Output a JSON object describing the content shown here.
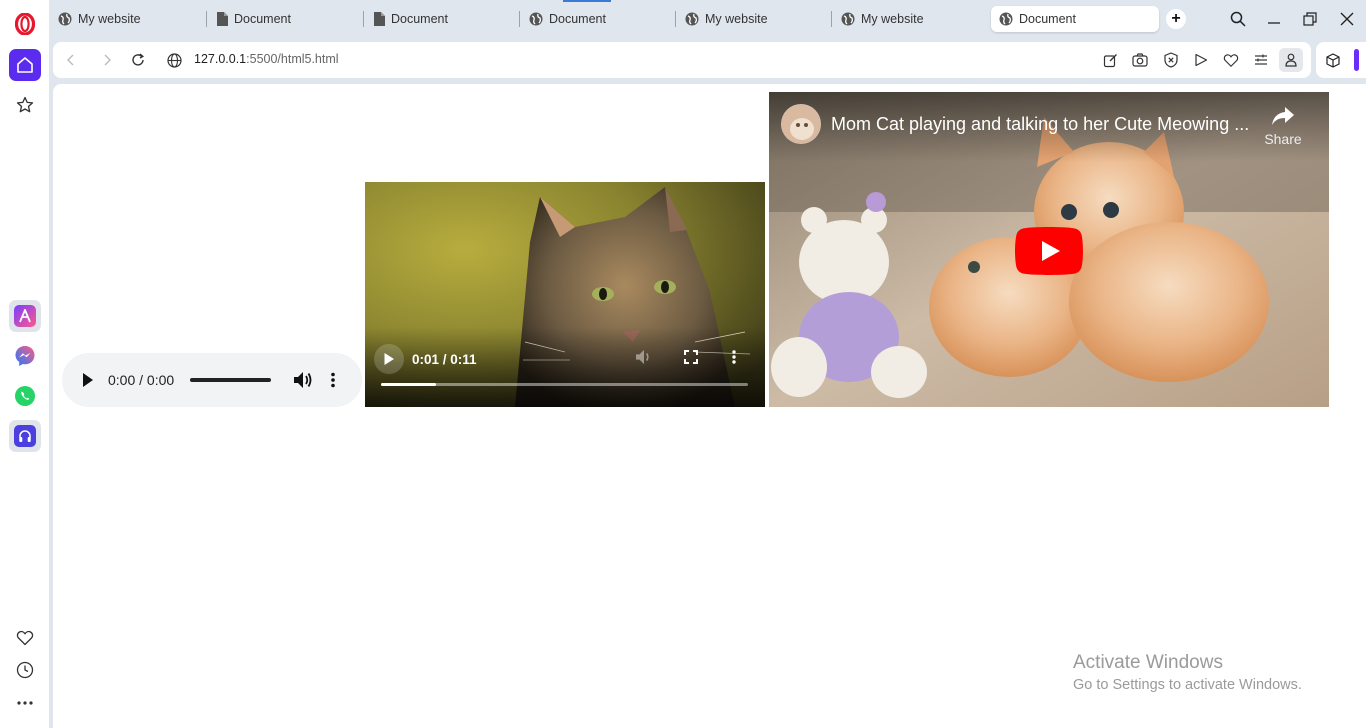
{
  "browser": {
    "tabs": [
      {
        "title": "My website",
        "icon": "globe-icon",
        "active": false
      },
      {
        "title": "Document",
        "icon": "document-icon",
        "active": false
      },
      {
        "title": "Document",
        "icon": "document-icon",
        "active": false
      },
      {
        "title": "Document",
        "icon": "globe-icon",
        "active": false
      },
      {
        "title": "My website",
        "icon": "globe-icon",
        "active": false
      },
      {
        "title": "My website",
        "icon": "globe-icon",
        "active": false
      },
      {
        "title": "Document",
        "icon": "globe-icon",
        "active": true
      }
    ],
    "address": {
      "host": "127.0.0.1",
      "path": ":5500/html5.html"
    },
    "accent_color": "#6a2bff"
  },
  "sidebar": {
    "items": [
      {
        "name": "opera-logo",
        "icon": "opera-icon"
      },
      {
        "name": "home",
        "icon": "home-icon"
      },
      {
        "name": "speed-dial",
        "icon": "star-icon"
      },
      {
        "name": "aria",
        "icon": "aria-icon"
      },
      {
        "name": "messenger",
        "icon": "messenger-icon"
      },
      {
        "name": "whatsapp",
        "icon": "whatsapp-icon"
      },
      {
        "name": "music-player",
        "icon": "headphones-icon"
      },
      {
        "name": "bookmarks",
        "icon": "heart-icon"
      },
      {
        "name": "history",
        "icon": "clock-icon"
      },
      {
        "name": "more",
        "icon": "more-icon"
      }
    ]
  },
  "page": {
    "audio": {
      "time": "0:00 / 0:00",
      "volume": 1.0
    },
    "video": {
      "time": "0:01 / 0:11",
      "progress": 0.15
    },
    "youtube": {
      "title": "Mom Cat playing and talking to her Cute Meowing ...",
      "share_label": "Share"
    }
  },
  "watermark": {
    "line1": "Activate Windows",
    "line2": "Go to Settings to activate Windows."
  }
}
